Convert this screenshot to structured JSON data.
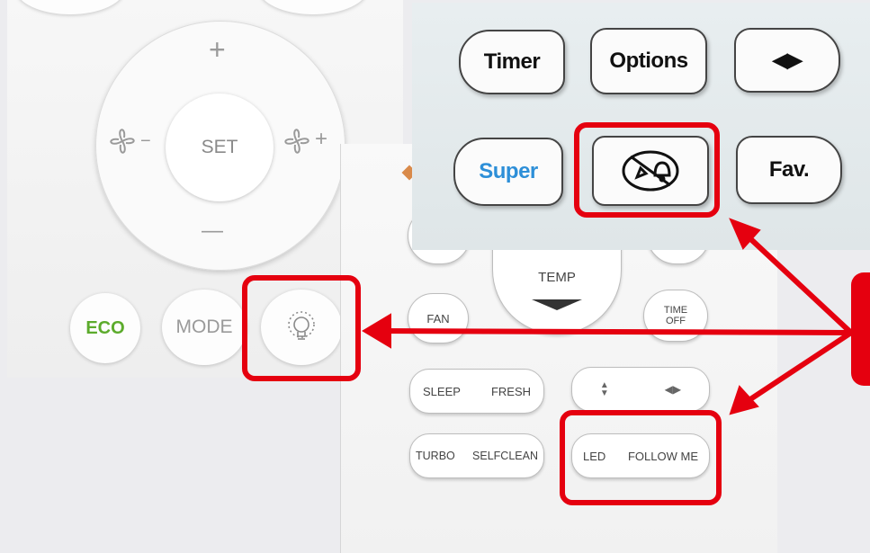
{
  "remote_left": {
    "set_label": "SET",
    "plus_glyph": "+",
    "minus_glyph": "—",
    "fan_minus_glyph": "−",
    "fan_plus_glyph": "+",
    "eco_label": "ECO",
    "mode_label": "MODE"
  },
  "remote_right": {
    "temp_label": "TEMP",
    "fan_label": "FAN",
    "time_off_label": "TIME\nOFF",
    "sleep_label": "SLEEP",
    "fresh_label": "FRESH",
    "turbo_label": "TURBO",
    "selfclean_label": "SELFCLEAN",
    "led_label": "LED",
    "follow_me_label": "FOLLOW ME",
    "swing_vertical_glyph": "▲▼",
    "swing_horizontal_glyph": "◀▶"
  },
  "inset": {
    "timer_label": "Timer",
    "options_label": "Options",
    "swing_glyph": "◀▶",
    "super_label": "Super",
    "fav_label": "Fav."
  },
  "colors": {
    "highlight": "#e5000f",
    "eco_green": "#5cab2c",
    "super_blue": "#2d8fd8"
  },
  "icons": [
    "fan-low-icon",
    "fan-high-icon",
    "light-bulb-icon",
    "light-and-bell-off-icon",
    "triangle-down-icon"
  ]
}
